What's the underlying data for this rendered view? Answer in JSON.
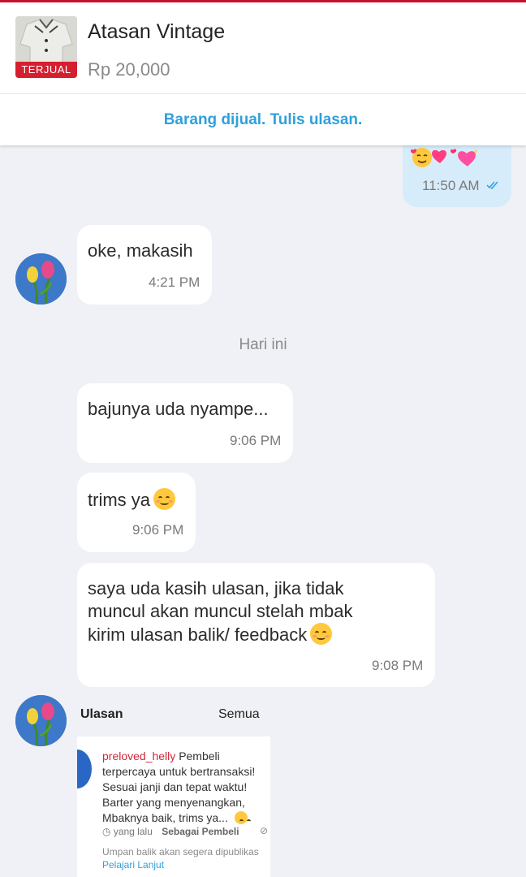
{
  "product": {
    "title": "Atasan Vintage",
    "price": "Rp 20,000",
    "badge": "TERJUAL",
    "thumbnail_icon": "shirt-icon"
  },
  "banner": {
    "text": "Barang dijual. Tulis ulasan."
  },
  "messages": [
    {
      "direction": "out",
      "emoji": "smiling-face-with-hearts-emoji",
      "time": "11:50 AM",
      "status_icon": "double-check-icon"
    },
    {
      "direction": "in",
      "text": "oke, makasih",
      "time": "4:21 PM"
    },
    {
      "direction": "in",
      "text": "bajunya uda nyampe...",
      "time": "9:06 PM"
    },
    {
      "direction": "in",
      "text": "trims ya",
      "emoji": "smiling-face-emoji",
      "time": "9:06 PM"
    },
    {
      "direction": "in",
      "lines": [
        "saya uda kasih ulasan, jika tidak",
        "muncul akan muncul stelah mbak",
        "kirim ulasan balik/ feedback"
      ],
      "emoji": "smiling-face-emoji",
      "time": "9:08 PM"
    }
  ],
  "day_separator": "Hari ini",
  "review_card": {
    "heading": "Ulasan",
    "all_label": "Semua",
    "username": "preloved_helly",
    "review_text": "Pembeli terpercaya untuk bertransaksi! Sesuai janji dan tepat waktu! Barter yang menyenangkan, Mbaknya baik, trims ya...",
    "time_label": "yang lalu",
    "role": "Sebagai Pembeli",
    "notice": "Umpan balik akan segera dipublikas",
    "learn_more": "Pelajari Lanjut"
  },
  "colors": {
    "accent_blue": "#2fa0dc",
    "sold_red": "#d51f2f",
    "outgoing_bubble": "#d6ecfb",
    "chat_background": "#f0f1f6",
    "username_red": "#d0263a"
  }
}
